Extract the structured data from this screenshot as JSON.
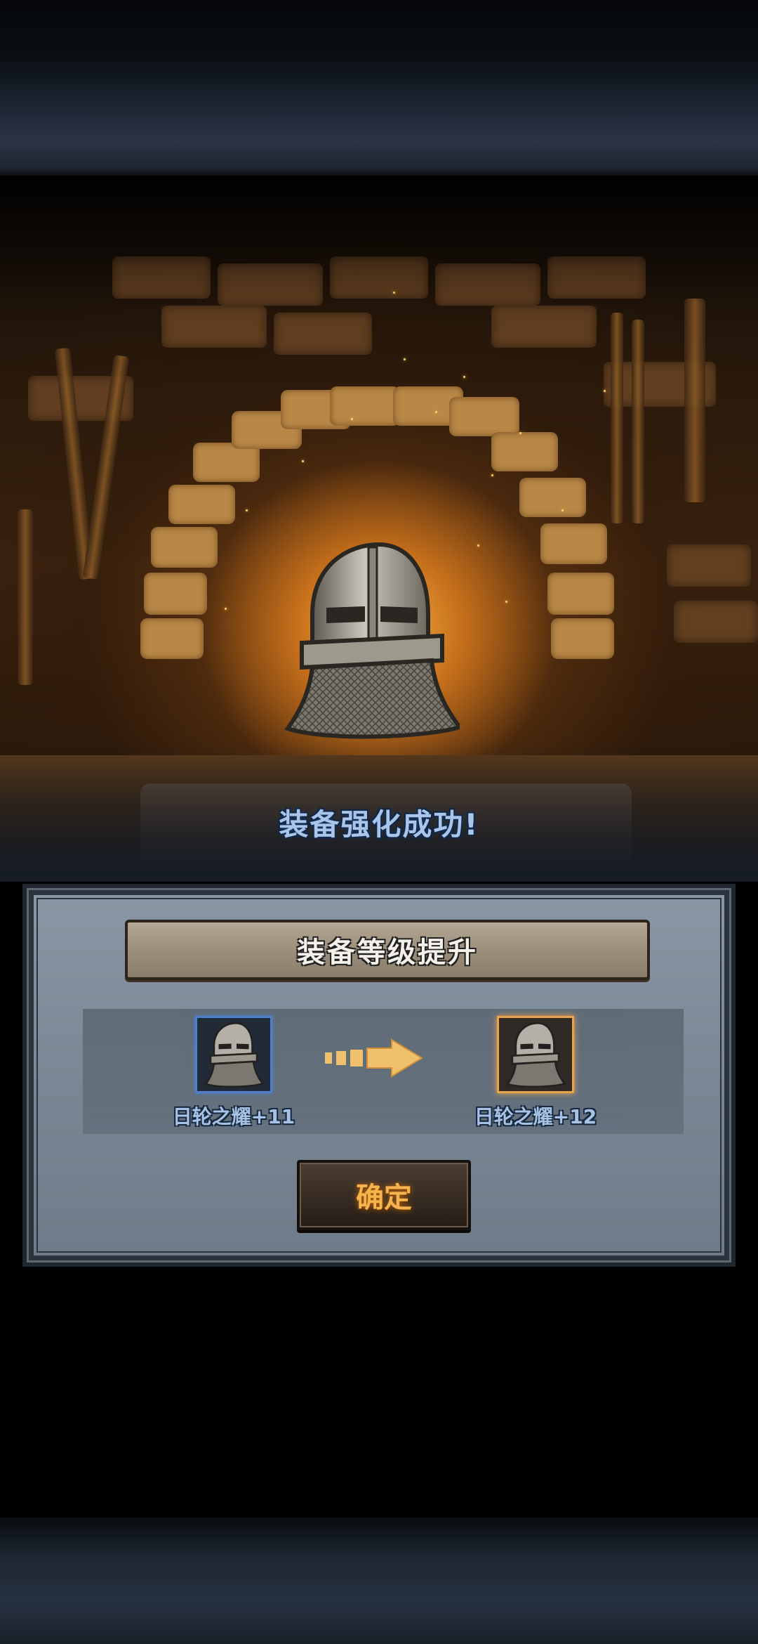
{
  "scene": {
    "success_message": "装备强化成功!",
    "item_icon": "knight-helmet-icon"
  },
  "upgrade_panel": {
    "title": "装备等级提升",
    "before": {
      "name": "日轮之耀+11",
      "icon": "knight-helmet-icon",
      "frame_color": "#4d7fd0"
    },
    "after": {
      "name": "日轮之耀+12",
      "icon": "knight-helmet-icon",
      "frame_color": "#f0a54a"
    },
    "arrow_icon": "dashed-arrow-right-icon",
    "confirm_label": "确定"
  },
  "colors": {
    "success_text": "#a9c6ea",
    "confirm_text": "#f6b44c"
  }
}
